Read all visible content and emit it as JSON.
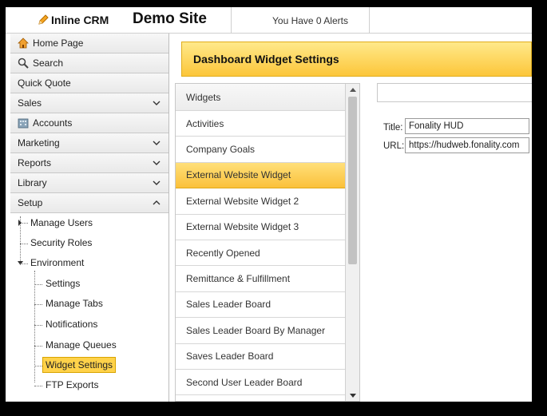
{
  "header": {
    "logo_text": "Inline CRM",
    "site_title": "Demo Site",
    "alerts": "You Have 0 Alerts"
  },
  "sidebar": {
    "items": [
      {
        "label": "Home Page",
        "icon": "home-icon"
      },
      {
        "label": "Search",
        "icon": "search-icon"
      },
      {
        "label": "Quick Quote"
      },
      {
        "label": "Sales",
        "chevron": "down"
      },
      {
        "label": "Accounts",
        "icon": "accounts-icon"
      },
      {
        "label": "Marketing",
        "chevron": "down"
      },
      {
        "label": "Reports",
        "chevron": "down"
      },
      {
        "label": "Library",
        "chevron": "down"
      },
      {
        "label": "Setup",
        "chevron": "up"
      }
    ],
    "tree": {
      "manage_users": "Manage Users",
      "security_roles": "Security Roles",
      "environment": "Environment",
      "settings": "Settings",
      "manage_tabs": "Manage Tabs",
      "notifications": "Notifications",
      "manage_queues": "Manage Queues",
      "widget_settings": "Widget Settings",
      "ftp_exports": "FTP Exports"
    }
  },
  "main": {
    "title": "Dashboard Widget Settings",
    "widgets_header": "Widgets",
    "widgets": [
      "Activities",
      "Company Goals",
      "External Website Widget",
      "External Website Widget 2",
      "External Website Widget 3",
      "Recently Opened",
      "Remittance & Fulfillment",
      "Sales Leader Board",
      "Sales Leader Board By Manager",
      "Saves Leader Board",
      "Second User Leader Board"
    ],
    "selected_widget": "External Website Widget",
    "form": {
      "title_label": "Title:",
      "title_value": "Fonality HUD",
      "url_label": "URL:",
      "url_value": "https://hudweb.fonality.com"
    }
  },
  "colors": {
    "accent": "#fcc63a",
    "accent_border": "#e0ad1d",
    "frame": "#000000"
  }
}
